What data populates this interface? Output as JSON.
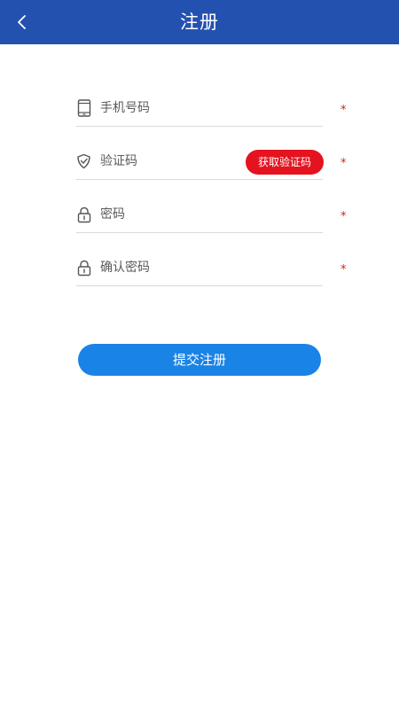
{
  "header": {
    "title": "注册",
    "back_icon": "chevron-left-icon",
    "background": "#2351b0"
  },
  "form": {
    "phone": {
      "placeholder": "手机号码",
      "value": "",
      "icon": "mobile-phone-icon",
      "required_mark": "*"
    },
    "code": {
      "placeholder": "验证码",
      "value": "",
      "icon": "shield-check-icon",
      "required_mark": "*"
    },
    "password": {
      "placeholder": "密码",
      "value": "",
      "icon": "lock-icon",
      "required_mark": "*"
    },
    "confirm_password": {
      "placeholder": "确认密码",
      "value": "",
      "icon": "lock-icon",
      "required_mark": "*"
    },
    "get_code_label": "获取验证码",
    "submit_label": "提交注册"
  },
  "colors": {
    "header": "#2351b0",
    "code_button": "#e4131f",
    "submit_button": "#1a83e6",
    "required": "#d32222"
  }
}
